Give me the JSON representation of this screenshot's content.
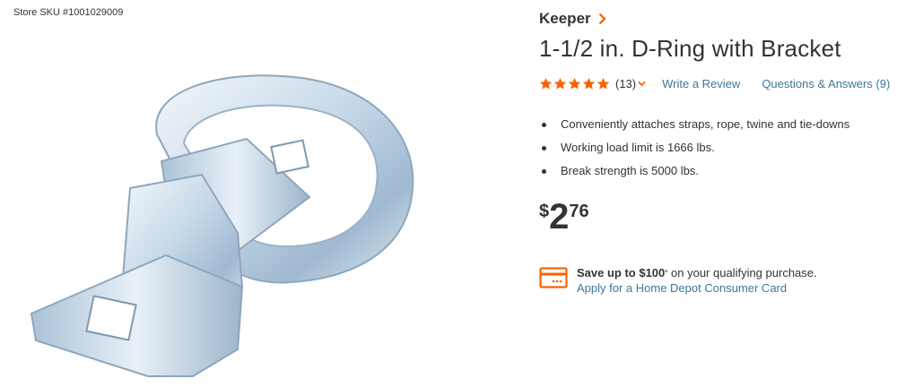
{
  "store_sku": "Store SKU #1001029009",
  "brand": {
    "name": "Keeper",
    "chevron_icon": "chevron-right-icon",
    "color": "#f96302"
  },
  "title": "1-1/2 in. D-Ring with Bracket",
  "rating": {
    "stars_filled": 5,
    "stars_total": 5,
    "count": "(13)",
    "star_color": "#f96302",
    "write_review": "Write a Review",
    "questions_answers": "Questions & Answers (9)"
  },
  "bullets": [
    "Conveniently attaches straps, rope, twine and tie-downs",
    "Working load limit is 1666 lbs.",
    "Break strength is 5000 lbs."
  ],
  "price": {
    "currency": "$",
    "dollars": "2",
    "cents": "76"
  },
  "promo": {
    "icon": "credit-card-icon",
    "headline": "Save up to $100",
    "sup": "*",
    "suffix": " on your qualifying purchase.",
    "link": "Apply for a Home Depot Consumer Card"
  },
  "colors": {
    "accent": "#f96302",
    "link": "#3e7697",
    "text": "#333333"
  }
}
